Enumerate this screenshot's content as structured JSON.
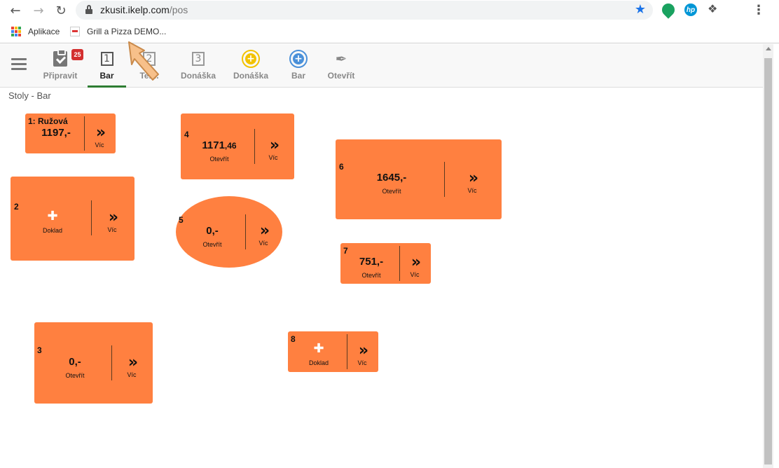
{
  "browser": {
    "url_host": "zkusit.ikelp.com",
    "url_path": "/pos",
    "bookmarks": [
      {
        "label": "Aplikace"
      },
      {
        "label": "Grill a Pizza DEMO..."
      }
    ]
  },
  "toolbar": {
    "items": [
      {
        "label": "Připravit",
        "badge": "25",
        "icon": "clipboard-check-icon"
      },
      {
        "label": "Bar",
        "number": "1",
        "icon": "number-box-icon",
        "active": true
      },
      {
        "label": "Ter...",
        "number": "2",
        "icon": "number-box-icon"
      },
      {
        "label": "Donáška",
        "number": "3",
        "icon": "number-box-icon"
      },
      {
        "label": "Donáška",
        "icon": "plus-circle-yellow-icon"
      },
      {
        "label": "Bar",
        "icon": "plus-circle-blue-icon"
      },
      {
        "label": "Otevřít",
        "icon": "bottle-open-icon"
      }
    ]
  },
  "breadcrumb": "Stoly - Bar",
  "tables": [
    {
      "number": "1: Ružová",
      "amount": "1197,-",
      "status": "",
      "more": "Víc"
    },
    {
      "number": "2",
      "amount": "",
      "status": "Doklad",
      "more": "Víc"
    },
    {
      "number": "3",
      "amount": "0,-",
      "status": "Otevřít",
      "more": "Víc"
    },
    {
      "number": "4",
      "amount": "1171",
      "amount_decimal": ",46",
      "status": "Otevřít",
      "more": "Víc"
    },
    {
      "number": "5",
      "amount": "0,-",
      "status": "Otevřít",
      "more": "Víc"
    },
    {
      "number": "6",
      "amount": "1645,-",
      "status": "Otevřít",
      "more": "Víc"
    },
    {
      "number": "7",
      "amount": "751,-",
      "status": "Otevřít",
      "more": "Víc"
    },
    {
      "number": "8",
      "amount": "",
      "status": "Doklad",
      "more": "Víc"
    }
  ],
  "colors": {
    "table": "#ff8040",
    "active_tab": "#2e7d32",
    "badge": "#d32f2f"
  }
}
